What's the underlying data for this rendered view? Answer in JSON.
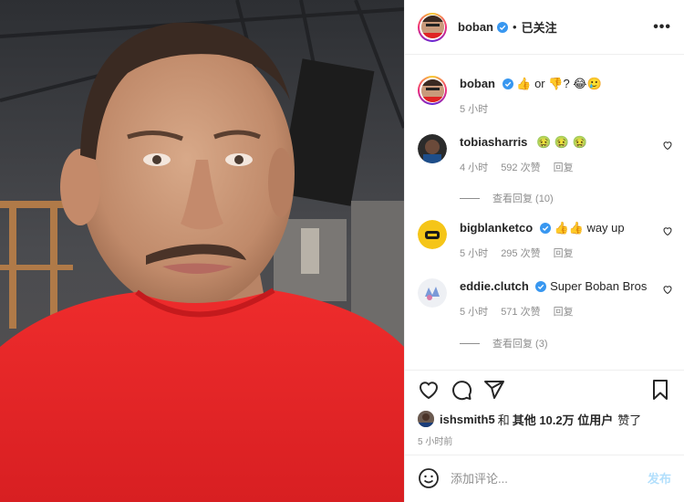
{
  "post": {
    "author": "boban",
    "follow_status": "已关注",
    "more": "•••",
    "caption": {
      "author": "boban",
      "text": "or",
      "q": "?",
      "trail": "🥲",
      "time": "5 小时"
    }
  },
  "comments": [
    {
      "user": "tobiasharris",
      "verified": false,
      "text": "",
      "emoji": [
        "🤢",
        "🤢",
        "🤢"
      ],
      "time": "4 小时",
      "likes": "592 次赞",
      "reply": "回复",
      "view_replies": "查看回复 (10)"
    },
    {
      "user": "bigblanketco",
      "verified": true,
      "text": "way up",
      "emoji": [
        "👍",
        "👍"
      ],
      "time": "5 小时",
      "likes": "295 次赞",
      "reply": "回复"
    },
    {
      "user": "eddie.clutch",
      "verified": true,
      "text": "Super Boban Bros",
      "emoji": [],
      "time": "5 小时",
      "likes": "571 次赞",
      "reply": "回复",
      "view_replies": "查看回复 (3)"
    }
  ],
  "likes_line": {
    "user": "ishsmith5",
    "and": "和",
    "others": "其他 10.2万 位用户",
    "suffix": "赞了"
  },
  "timestamp": "5 小时前",
  "add_comment": {
    "placeholder": "添加评论...",
    "post_label": "发布"
  },
  "colors": {
    "verified": "#3897f0",
    "meta": "#8e8e8e",
    "shirt": "#e02424",
    "post_button": "#b2dffc"
  },
  "icons": [
    "heart-icon",
    "comment-icon",
    "share-icon",
    "bookmark-icon",
    "emoji-icon",
    "verified-icon",
    "more-icon"
  ]
}
